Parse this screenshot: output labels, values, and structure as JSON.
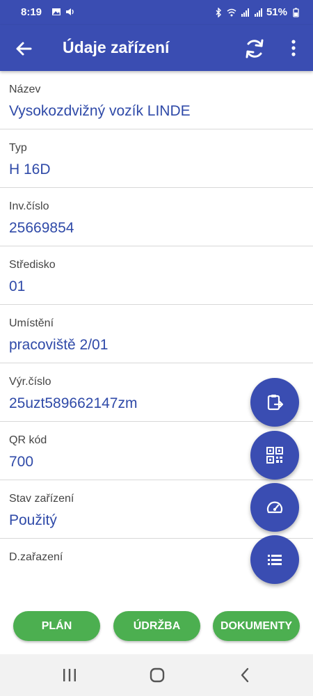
{
  "status_bar": {
    "time": "8:19",
    "battery": "51%",
    "icons": [
      "image-icon",
      "voice-icon",
      "bluetooth-icon",
      "wifi-icon",
      "signal-icon",
      "signal-icon",
      "battery-icon"
    ]
  },
  "app_bar": {
    "title": "Údaje zařízení",
    "icons": [
      "back-arrow-icon",
      "refresh-icon",
      "more-vert-icon"
    ]
  },
  "fields": [
    {
      "label": "Název",
      "value": "Vysokozdvižný vozík LINDE"
    },
    {
      "label": "Typ",
      "value": "H 16D"
    },
    {
      "label": "Inv.číslo",
      "value": "25669854"
    },
    {
      "label": "Středisko",
      "value": "01"
    },
    {
      "label": "Umístění",
      "value": "pracoviště 2/01"
    },
    {
      "label": "Výr.číslo",
      "value": "25uzt589662147zm"
    },
    {
      "label": "QR kód",
      "value": "700"
    },
    {
      "label": "Stav zařízení",
      "value": "Použitý"
    },
    {
      "label": "D.zařazení",
      "value": ""
    }
  ],
  "fabs": [
    "clipboard-transfer-icon",
    "qr-code-icon",
    "speedometer-icon",
    "list-icon"
  ],
  "buttons": {
    "plan": "PLÁN",
    "maintenance": "ÚDRŽBA",
    "documents": "DOKUMENTY"
  },
  "nav": [
    "recent-apps-icon",
    "home-icon",
    "back-icon"
  ],
  "colors": {
    "primary": "#3a4db2",
    "value_text": "#2f4aa8",
    "button_green": "#4caf50"
  }
}
